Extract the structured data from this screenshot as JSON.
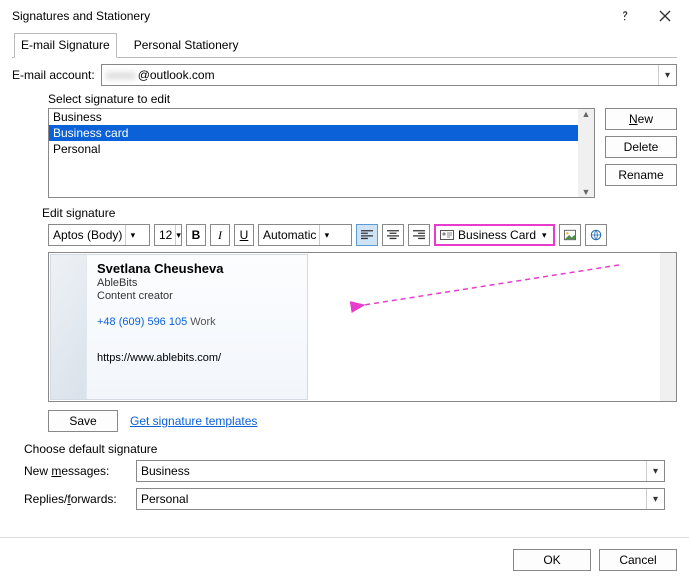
{
  "window": {
    "title": "Signatures and Stationery"
  },
  "tabs": {
    "email": "E-mail Signature",
    "stationery": "Personal Stationery"
  },
  "account": {
    "label": "E-mail account:",
    "domain": "@outlook.com",
    "local_blur": "xxxxx"
  },
  "section": {
    "select": "Select signature to edit",
    "edit": "Edit signature",
    "choose": "Choose default signature"
  },
  "signatures": {
    "items": [
      "Business",
      "Business card",
      "Personal"
    ],
    "selected_index": 1
  },
  "buttons": {
    "new": "New",
    "delete": "Delete",
    "rename": "Rename",
    "save": "Save",
    "ok": "OK",
    "cancel": "Cancel",
    "templates": "Get signature templates",
    "bcard": "Business Card"
  },
  "toolbar": {
    "font": "Aptos (Body)",
    "size": "12",
    "color": "Automatic",
    "b": "B",
    "i": "I",
    "u": "U"
  },
  "card": {
    "name": "Svetlana Cheusheva",
    "company": "AbleBits",
    "role": "Content creator",
    "phone": "+48 (609) 596 105",
    "phone_label": "Work",
    "url": "https://www.ablebits.com/"
  },
  "defaults": {
    "newmsg_label": "New messages:",
    "newmsg_value": "Business",
    "reply_label": "Replies/forwards:",
    "reply_value": "Personal"
  }
}
